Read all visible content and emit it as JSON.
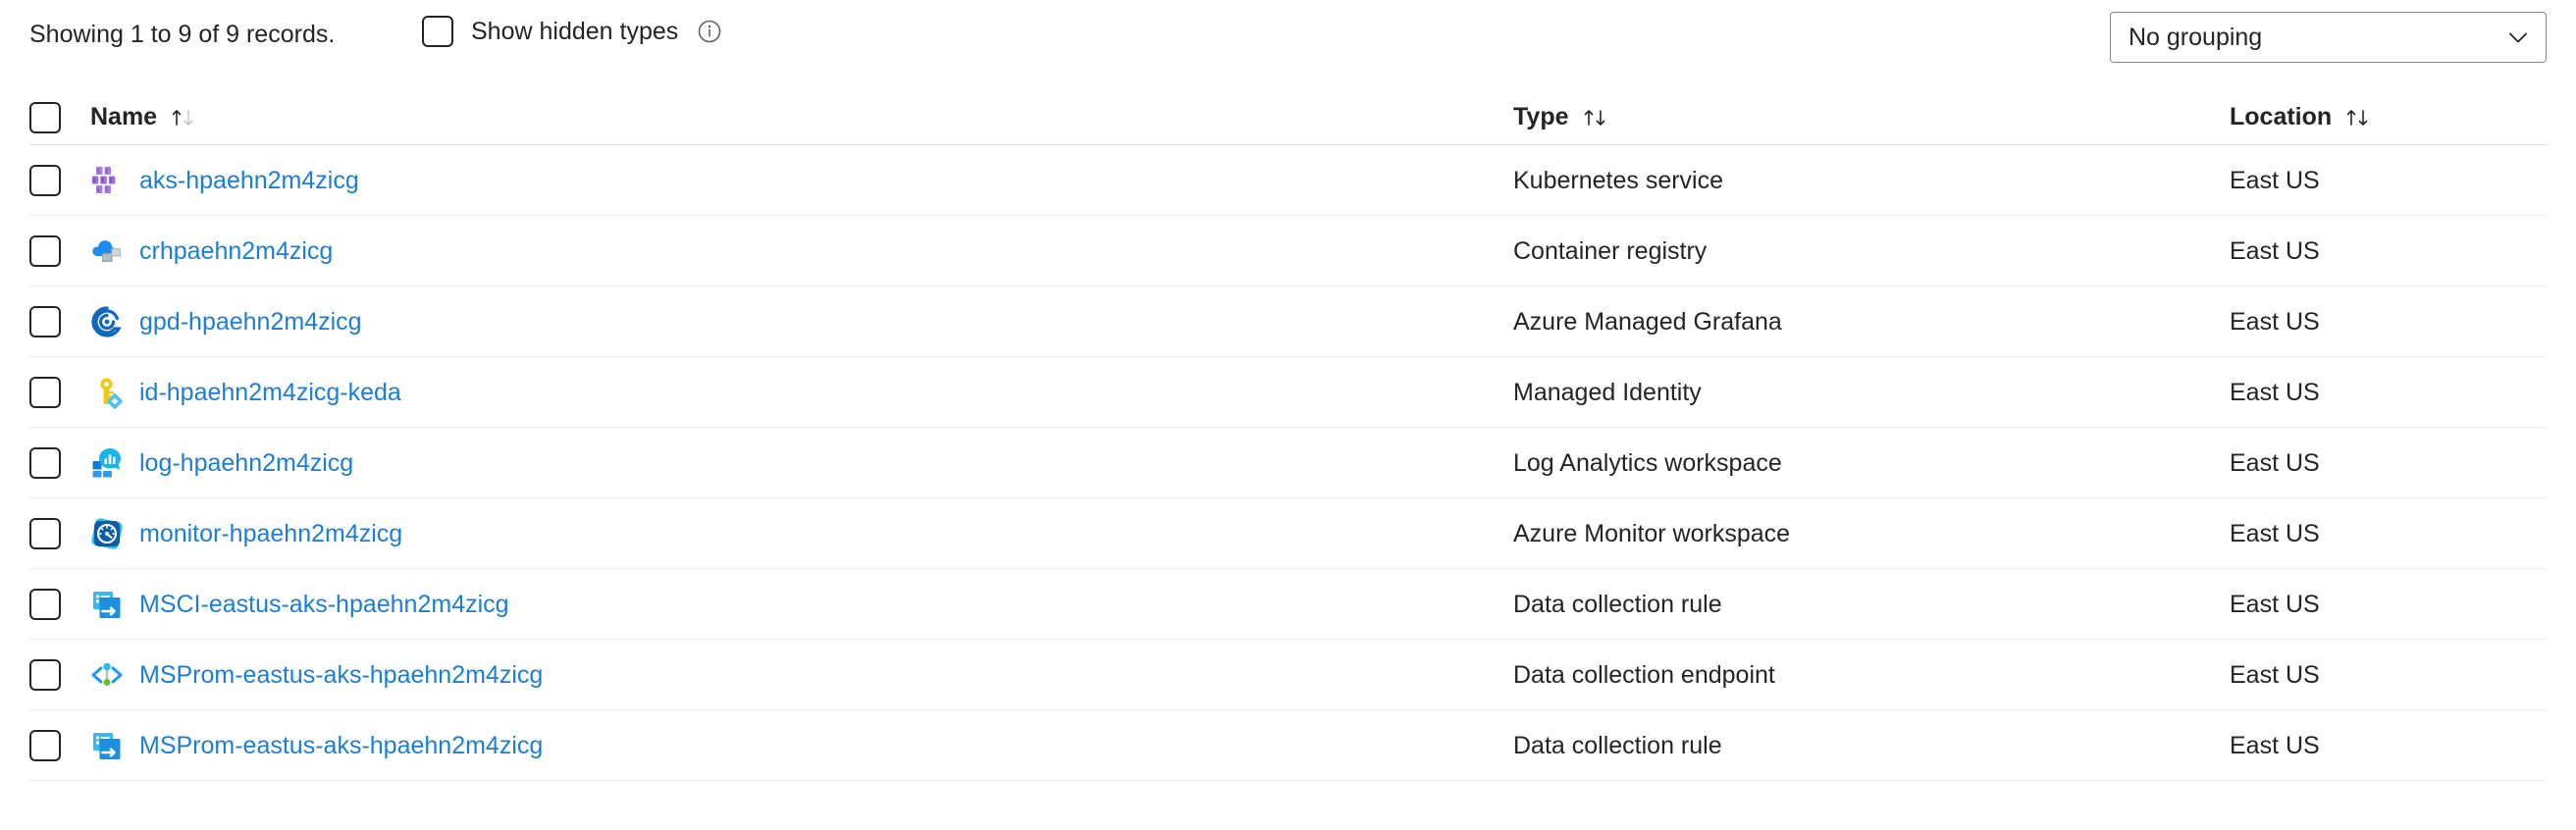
{
  "toolbar": {
    "records_text": "Showing 1 to 9 of 9 records.",
    "show_hidden_types_label": "Show hidden types",
    "show_hidden_types_checked": false,
    "info_icon": "info-circle-icon",
    "grouping": {
      "selected": "No grouping",
      "chevron_icon": "chevron-down-icon"
    }
  },
  "table": {
    "select_all_checked": false,
    "columns": [
      {
        "key": "name",
        "label": "Name",
        "sort_icon": "sort-ascending-icon",
        "sort_state": "ascending"
      },
      {
        "key": "type",
        "label": "Type",
        "sort_icon": "sort-icon",
        "sort_state": "none"
      },
      {
        "key": "location",
        "label": "Location",
        "sort_icon": "sort-icon",
        "sort_state": "none"
      }
    ],
    "rows": [
      {
        "checked": false,
        "icon": "kubernetes-service-icon",
        "name": "aks-hpaehn2m4zicg",
        "type": "Kubernetes service",
        "location": "East US"
      },
      {
        "checked": false,
        "icon": "container-registry-icon",
        "name": "crhpaehn2m4zicg",
        "type": "Container registry",
        "location": "East US"
      },
      {
        "checked": false,
        "icon": "azure-managed-grafana-icon",
        "name": "gpd-hpaehn2m4zicg",
        "type": "Azure Managed Grafana",
        "location": "East US"
      },
      {
        "checked": false,
        "icon": "managed-identity-icon",
        "name": "id-hpaehn2m4zicg-keda",
        "type": "Managed Identity",
        "location": "East US"
      },
      {
        "checked": false,
        "icon": "log-analytics-workspace-icon",
        "name": "log-hpaehn2m4zicg",
        "type": "Log Analytics workspace",
        "location": "East US"
      },
      {
        "checked": false,
        "icon": "azure-monitor-workspace-icon",
        "name": "monitor-hpaehn2m4zicg",
        "type": "Azure Monitor workspace",
        "location": "East US"
      },
      {
        "checked": false,
        "icon": "data-collection-rule-icon",
        "name": "MSCI-eastus-aks-hpaehn2m4zicg",
        "type": "Data collection rule",
        "location": "East US"
      },
      {
        "checked": false,
        "icon": "data-collection-endpoint-icon",
        "name": "MSProm-eastus-aks-hpaehn2m4zicg",
        "type": "Data collection endpoint",
        "location": "East US"
      },
      {
        "checked": false,
        "icon": "data-collection-rule-icon",
        "name": "MSProm-eastus-aks-hpaehn2m4zicg",
        "type": "Data collection rule",
        "location": "East US"
      }
    ]
  },
  "colors": {
    "link": "#1a7fd4",
    "text": "#242424",
    "row_divider": "#ebebeb",
    "checkbox_border": "#242424",
    "dropdown_border": "#8a8886",
    "kubernetes_purple": "#9b6fd6",
    "container_blue": "#1f8bed",
    "grafana_blue": "#0f6cbd",
    "identity_yellow": "#f2c811",
    "monitor_blue": "#0b5da8",
    "endpoint_blue": "#2196f3"
  }
}
